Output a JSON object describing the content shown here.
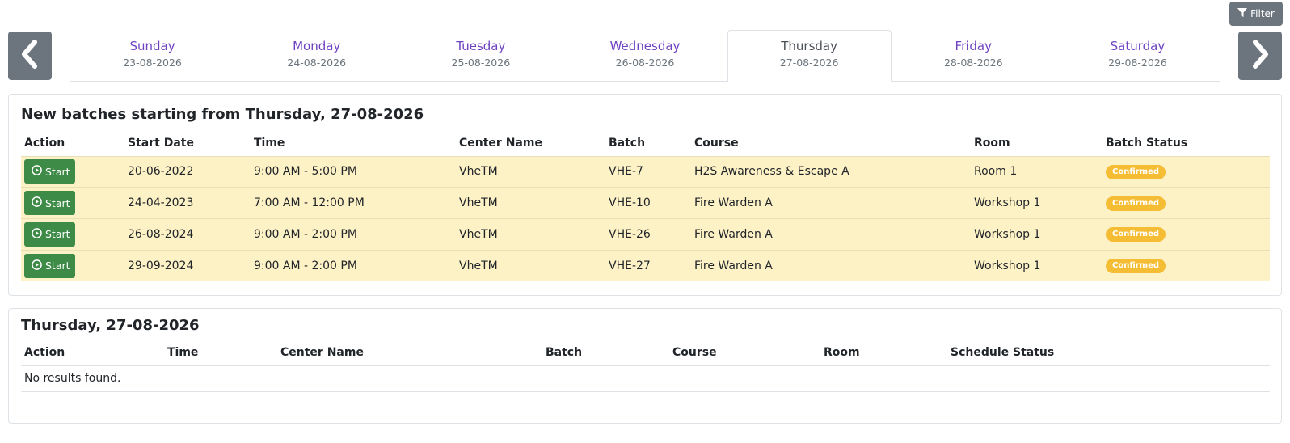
{
  "toolbar": {
    "filter_label": "Filter",
    "filter_icon": "filter-icon"
  },
  "nav": {
    "prev_icon": "chevron-left-icon",
    "next_icon": "chevron-right-icon"
  },
  "days": [
    {
      "name": "Sunday",
      "date": "23-08-2026",
      "active": false
    },
    {
      "name": "Monday",
      "date": "24-08-2026",
      "active": false
    },
    {
      "name": "Tuesday",
      "date": "25-08-2026",
      "active": false
    },
    {
      "name": "Wednesday",
      "date": "26-08-2026",
      "active": false
    },
    {
      "name": "Thursday",
      "date": "27-08-2026",
      "active": true
    },
    {
      "name": "Friday",
      "date": "28-08-2026",
      "active": false
    },
    {
      "name": "Saturday",
      "date": "29-08-2026",
      "active": false
    }
  ],
  "batches": {
    "title": "New batches starting from Thursday, 27-08-2026",
    "columns": [
      "Action",
      "Start Date",
      "Time",
      "Center Name",
      "Batch",
      "Course",
      "Room",
      "Batch Status"
    ],
    "rows": [
      {
        "action": "Start",
        "start_date": "20-06-2022",
        "time": "9:00 AM - 5:00 PM",
        "center": "VheTM",
        "batch": "VHE-7",
        "course": "H2S Awareness & Escape A",
        "room": "Room 1",
        "status": "Confirmed"
      },
      {
        "action": "Start",
        "start_date": "24-04-2023",
        "time": "7:00 AM - 12:00 PM",
        "center": "VheTM",
        "batch": "VHE-10",
        "course": "Fire Warden A",
        "room": "Workshop 1",
        "status": "Confirmed"
      },
      {
        "action": "Start",
        "start_date": "26-08-2024",
        "time": "9:00 AM - 2:00 PM",
        "center": "VheTM",
        "batch": "VHE-26",
        "course": "Fire Warden A",
        "room": "Workshop 1",
        "status": "Confirmed"
      },
      {
        "action": "Start",
        "start_date": "29-09-2024",
        "time": "9:00 AM - 2:00 PM",
        "center": "VheTM",
        "batch": "VHE-27",
        "course": "Fire Warden A",
        "room": "Workshop 1",
        "status": "Confirmed"
      }
    ]
  },
  "schedule": {
    "title": "Thursday, 27-08-2026",
    "columns": [
      "Action",
      "Time",
      "Center Name",
      "Batch",
      "Course",
      "Room",
      "Schedule Status"
    ],
    "empty_text": "No results found."
  },
  "colors": {
    "row_highlight": "#fdf1c6",
    "start_button": "#3d8b47",
    "badge_confirmed": "#f5bd33",
    "day_link": "#6f42c1",
    "nav_button": "#6c757d"
  }
}
